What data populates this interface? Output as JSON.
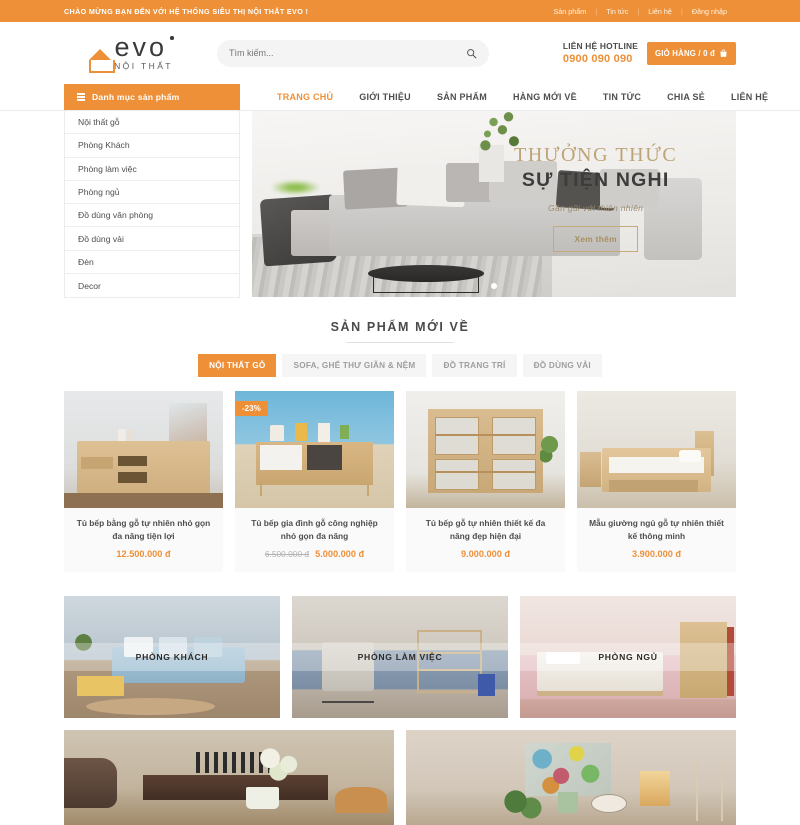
{
  "topbar": {
    "welcome": "CHÀO MỪNG BẠN ĐẾN VỚI HỆ THỐNG SIÊU THỊ NỘI THẤT EVO !",
    "links": [
      "Sản phẩm",
      "Tin tức",
      "Liên hệ",
      "Đăng nhập"
    ]
  },
  "header": {
    "logo_text": "evo",
    "logo_sub": "NỘI THẤT",
    "logo_icon": "house-icon",
    "search": {
      "placeholder": "Tìm kiếm...",
      "value": "",
      "icon": "search-icon"
    },
    "hotline_label": "LIÊN HỆ HOTLINE",
    "hotline_number": "0900 090 090",
    "cart_label": "GIỎ HÀNG / 0 đ",
    "cart_icon": "shopping-bag-icon"
  },
  "category_panel": {
    "title": "Danh mục sản phẩm",
    "icon": "hamburger-icon",
    "items": [
      "Nội thất gỗ",
      "Phòng Khách",
      "Phòng làm việc",
      "Phòng ngủ",
      "Đồ dùng văn phòng",
      "Đồ dùng vải",
      "Đèn",
      "Decor"
    ]
  },
  "mainnav": [
    {
      "label": "TRANG CHỦ",
      "active": true
    },
    {
      "label": "GIỚI THIỆU",
      "active": false
    },
    {
      "label": "SẢN PHẨM",
      "active": false
    },
    {
      "label": "HÀNG MỚI VỀ",
      "active": false
    },
    {
      "label": "TIN TỨC",
      "active": false
    },
    {
      "label": "CHIA SẺ",
      "active": false
    },
    {
      "label": "LIÊN HỆ",
      "active": false
    }
  ],
  "hero": {
    "line1": "THƯỞNG THỨC",
    "line2": "SỰ TIỆN NGHI",
    "tagline": "Gần gũi với thiên nhiên",
    "button": "Xem thêm",
    "slide_count": 1,
    "active_slide": 0
  },
  "products_section": {
    "title": "SẢN PHẨM MỚI VỀ",
    "tabs": [
      {
        "label": "NỘI THẤT GỖ",
        "active": true
      },
      {
        "label": "SOFA, GHẾ THƯ GIÃN & NỆM",
        "active": false
      },
      {
        "label": "ĐỒ TRANG TRÍ",
        "active": false
      },
      {
        "label": "ĐỒ DÙNG VẢI",
        "active": false
      }
    ],
    "items": [
      {
        "name": "Tủ bếp bằng gỗ tự nhiên nhỏ gọn đa năng tiện lợi",
        "price": "12.500.000 đ",
        "old_price": "",
        "badge": ""
      },
      {
        "name": "Tủ bếp gia đình gỗ công nghiệp nhỏ gọn đa năng",
        "price": "5.000.000 đ",
        "old_price": "6.500.000 đ",
        "badge": "-23%"
      },
      {
        "name": "Tủ bếp gỗ tự nhiên thiết kế đa năng đẹp hiện đại",
        "price": "9.000.000 đ",
        "old_price": "",
        "badge": ""
      },
      {
        "name": "Mẫu giường ngủ gỗ tự nhiên thiết kế thông minh",
        "price": "3.900.000 đ",
        "old_price": "",
        "badge": ""
      }
    ]
  },
  "category_banners": [
    {
      "label": "PHÒNG KHÁCH"
    },
    {
      "label": "PHÒNG LÀM VIỆC"
    },
    {
      "label": "PHÒNG NGỦ"
    }
  ],
  "bottom_banners": [
    {
      "label": ""
    },
    {
      "label": ""
    }
  ],
  "colors": {
    "brand_orange": "#ee9038",
    "gold": "#bda476",
    "text_dark": "#4a4a4a",
    "panel_gray": "#f5f5f5"
  }
}
